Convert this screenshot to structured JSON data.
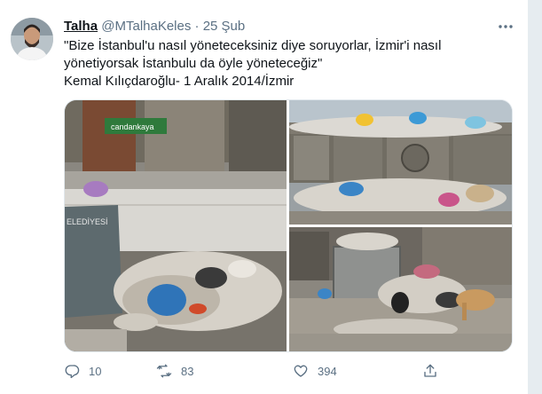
{
  "tweet": {
    "author_name": "Talha",
    "author_handle": "@MTalhaKeles",
    "separator": "·",
    "date": "25 Şub",
    "text_lines": [
      "\"Bize İstanbul'u nasıl yöneteceksiniz diye soruyorlar, İzmir'i nasıl",
      "yönetiyorsak İstanbulu da öyle yöneteceğiz\"",
      "Kemal Kılıçdaroğlu- 1 Aralık 2014/İzmir"
    ],
    "photo1_sign_text": "candankaya",
    "replies": "10",
    "retweets": "83",
    "likes": "394"
  },
  "colors": {
    "accent": "#1da1f2",
    "muted": "#5b7083",
    "background": "#e6ecf0"
  },
  "icons": [
    "more-icon",
    "reply-icon",
    "retweet-icon",
    "like-icon",
    "share-icon"
  ]
}
